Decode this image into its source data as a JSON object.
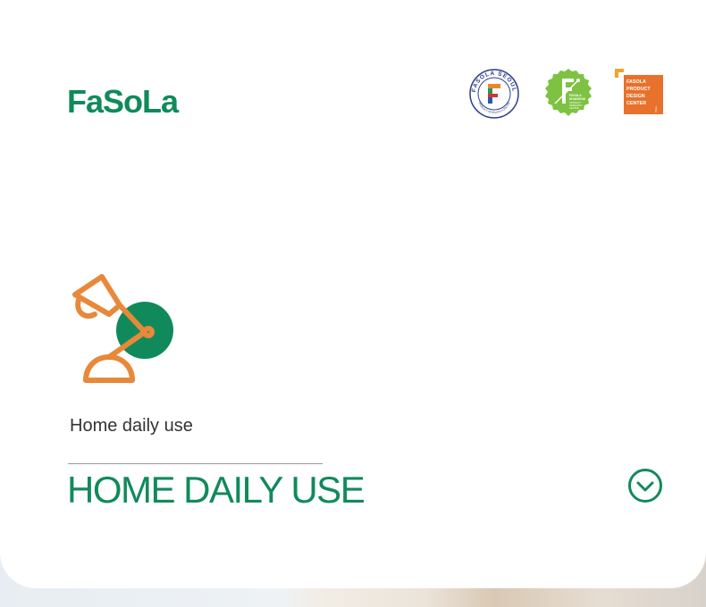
{
  "header": {
    "logo_text": "FaSoLa"
  },
  "badges": {
    "seoul": {
      "ring_text": "FASOLA SEOUL",
      "bottom_text": "PRODUCT RESEARCH CENTER"
    },
    "shanghai": {
      "line1": "FASOLA",
      "line2": "SHANGHAI",
      "line3": "PRODUCT",
      "line4": "RESEARCH",
      "line5": "CENTER"
    },
    "design": {
      "line1": "FASOLA",
      "line2": "PRODUCT",
      "line3": "DESIGN",
      "line4": "CENTER",
      "side": "Tokyo"
    }
  },
  "category": {
    "label": "Home daily use",
    "title": "HOME DAILY USE",
    "icon": "desk-lamp-icon"
  },
  "colors": {
    "brand_green": "#118a5b",
    "accent_orange": "#e8883a"
  }
}
